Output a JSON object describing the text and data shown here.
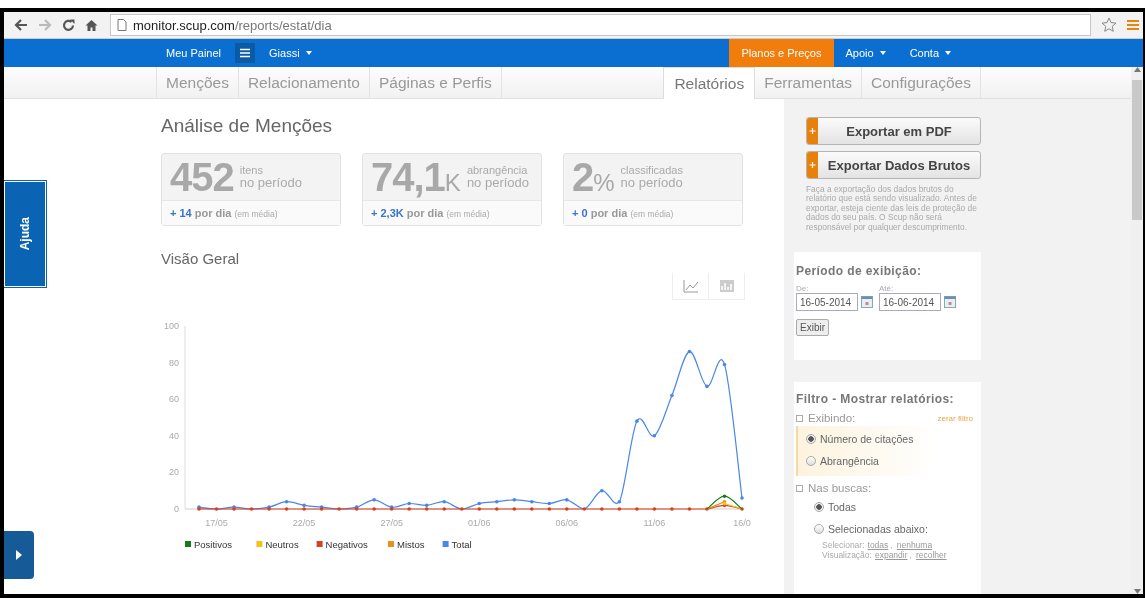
{
  "browser": {
    "url_host": "monitor.scup.com",
    "url_path": "/reports/estat/dia"
  },
  "nav": {
    "left": [
      {
        "label": "Meu Painel",
        "kind": "link"
      },
      {
        "kind": "menu"
      },
      {
        "label": "Giassi",
        "kind": "dropdown"
      }
    ],
    "right": [
      {
        "label": "Planos e Preços",
        "kind": "highlight"
      },
      {
        "label": "Apoio",
        "kind": "dropdown"
      },
      {
        "label": "Conta",
        "kind": "dropdown"
      }
    ]
  },
  "tabs_left": [
    {
      "label": "Menções",
      "selected": false
    },
    {
      "label": "Relacionamento",
      "selected": false
    },
    {
      "label": "Páginas e Perfis",
      "selected": false
    }
  ],
  "tabs_right": [
    {
      "label": "Relatórios",
      "selected": true
    },
    {
      "label": "Ferramentas",
      "selected": false
    },
    {
      "label": "Configurações",
      "selected": false
    }
  ],
  "help_tab": "Ajuda",
  "title": "Análise de Menções",
  "stats": [
    {
      "value": "452",
      "top": "itens",
      "bottom": "no período",
      "delta": "+ 14",
      "per": "por dia",
      "note": "(em média)"
    },
    {
      "value": "74,1",
      "unit": "K",
      "top": "abrangência",
      "bottom": "no período",
      "delta": "+ 2,3K",
      "per": "por dia",
      "note": "(em média)"
    },
    {
      "value": "2",
      "unit": "%",
      "top": "classificadas",
      "bottom": "no período",
      "delta": "+ 0",
      "per": "por dia",
      "note": "(em média)"
    }
  ],
  "overview": {
    "title": "Visão Geral",
    "views": [
      {
        "kind": "line",
        "selected": true
      },
      {
        "kind": "bar",
        "selected": false
      }
    ],
    "chart_data": {
      "type": "line",
      "legend": "bottom",
      "categories": [
        null,
        "17/05",
        null,
        null,
        null,
        null,
        "22/05",
        null,
        null,
        null,
        null,
        "27/05",
        null,
        null,
        null,
        null,
        "01/06",
        null,
        null,
        null,
        null,
        "06/06",
        null,
        null,
        null,
        null,
        "11/06",
        null,
        null,
        null,
        null,
        "16/0"
      ],
      "ylim": [
        0,
        100
      ],
      "yticks": [
        0,
        20,
        40,
        60,
        80,
        100
      ],
      "series": [
        {
          "name": "Positivos",
          "color": "#1a7a1a",
          "values": [
            null,
            null,
            null,
            null,
            null,
            null,
            null,
            null,
            null,
            null,
            null,
            null,
            null,
            null,
            null,
            null,
            null,
            null,
            null,
            null,
            null,
            null,
            null,
            null,
            null,
            null,
            null,
            null,
            null,
            0,
            7,
            0
          ]
        },
        {
          "name": "Neutros",
          "color": "#f0c419",
          "values": [
            null,
            null,
            null,
            null,
            null,
            null,
            null,
            null,
            null,
            null,
            null,
            null,
            null,
            null,
            null,
            null,
            null,
            null,
            null,
            null,
            null,
            null,
            null,
            null,
            null,
            null,
            null,
            null,
            null,
            null,
            3,
            0
          ]
        },
        {
          "name": "Negativos",
          "color": "#d9401c",
          "values": [
            0,
            0,
            0,
            0,
            0,
            0,
            0,
            0,
            0,
            0,
            0,
            0,
            0,
            0,
            0,
            0,
            0,
            0,
            0,
            0,
            0,
            0,
            0,
            0,
            0,
            0,
            0,
            0,
            0,
            0,
            2,
            0
          ]
        },
        {
          "name": "Mistos",
          "color": "#e8901c",
          "values": [
            null,
            null,
            null,
            null,
            null,
            null,
            null,
            null,
            null,
            null,
            null,
            null,
            null,
            null,
            null,
            null,
            null,
            null,
            null,
            null,
            null,
            null,
            null,
            null,
            null,
            null,
            null,
            null,
            null,
            0,
            4,
            null
          ]
        },
        {
          "name": "Total",
          "color": "#4a86e8",
          "values": [
            1,
            0,
            1,
            0,
            1,
            4,
            2,
            1,
            0,
            1,
            5,
            1,
            3,
            2,
            4,
            0,
            3,
            4,
            5,
            4,
            3,
            5,
            0,
            10,
            4,
            48,
            40,
            62,
            86,
            67,
            79,
            6
          ]
        }
      ]
    }
  },
  "export": {
    "buttons": [
      "Exportar em PDF",
      "Exportar Dados Brutos"
    ],
    "note": "Faça a exportação dos dados brutos do relatório que está sendo visualizado. Antes de exportar, esteja ciente das leis de proteção de dados do seu país. O Scup não será responsável por qualquer descumprimento."
  },
  "period": {
    "title": "Período de exibição:",
    "from_label": "De:",
    "from_value": "16-05-2014",
    "to_label": "Até:",
    "to_value": "16-06-2014",
    "submit": "Exibir"
  },
  "filter": {
    "title": "Filtro - Mostrar relatórios:",
    "reset": "zerar filtro",
    "groups": [
      {
        "label": "Exibindo:",
        "highlighted": true,
        "options": [
          {
            "label": "Número de citações",
            "selected": true
          },
          {
            "label": "Abrangência",
            "selected": false
          }
        ]
      },
      {
        "label": "Nas buscas:",
        "options": [
          {
            "label": "Todas",
            "selected": true
          },
          {
            "label": "Selecionadas abaixo:",
            "selected": false
          }
        ],
        "link_rows": [
          {
            "label": "Selecionar:",
            "links": [
              "todas",
              "nenhuma"
            ],
            "separator": ","
          },
          {
            "label": "Visualização:",
            "links": [
              "expandir",
              "recolher"
            ],
            "separator": ","
          }
        ]
      }
    ]
  }
}
